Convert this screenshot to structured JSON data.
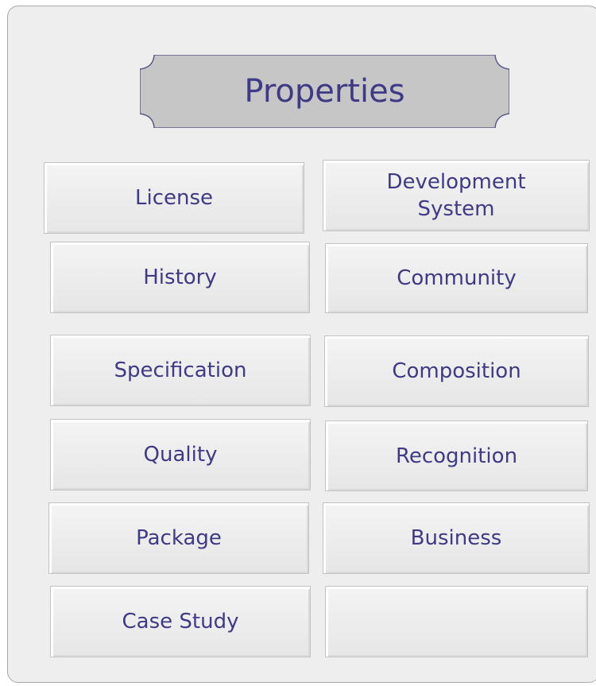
{
  "title": "Properties",
  "colors": {
    "text": "#3e3a85",
    "panel": "#eeeeee",
    "plaque": "#c6c6c6",
    "cell": "#eaeaea"
  },
  "cells": [
    {
      "label": "License"
    },
    {
      "label": "Development\nSystem"
    },
    {
      "label": "History"
    },
    {
      "label": "Community"
    },
    {
      "label": "Specification"
    },
    {
      "label": "Composition"
    },
    {
      "label": "Quality"
    },
    {
      "label": "Recognition"
    },
    {
      "label": "Package"
    },
    {
      "label": "Business"
    },
    {
      "label": "Case Study"
    },
    {
      "label": ""
    }
  ]
}
